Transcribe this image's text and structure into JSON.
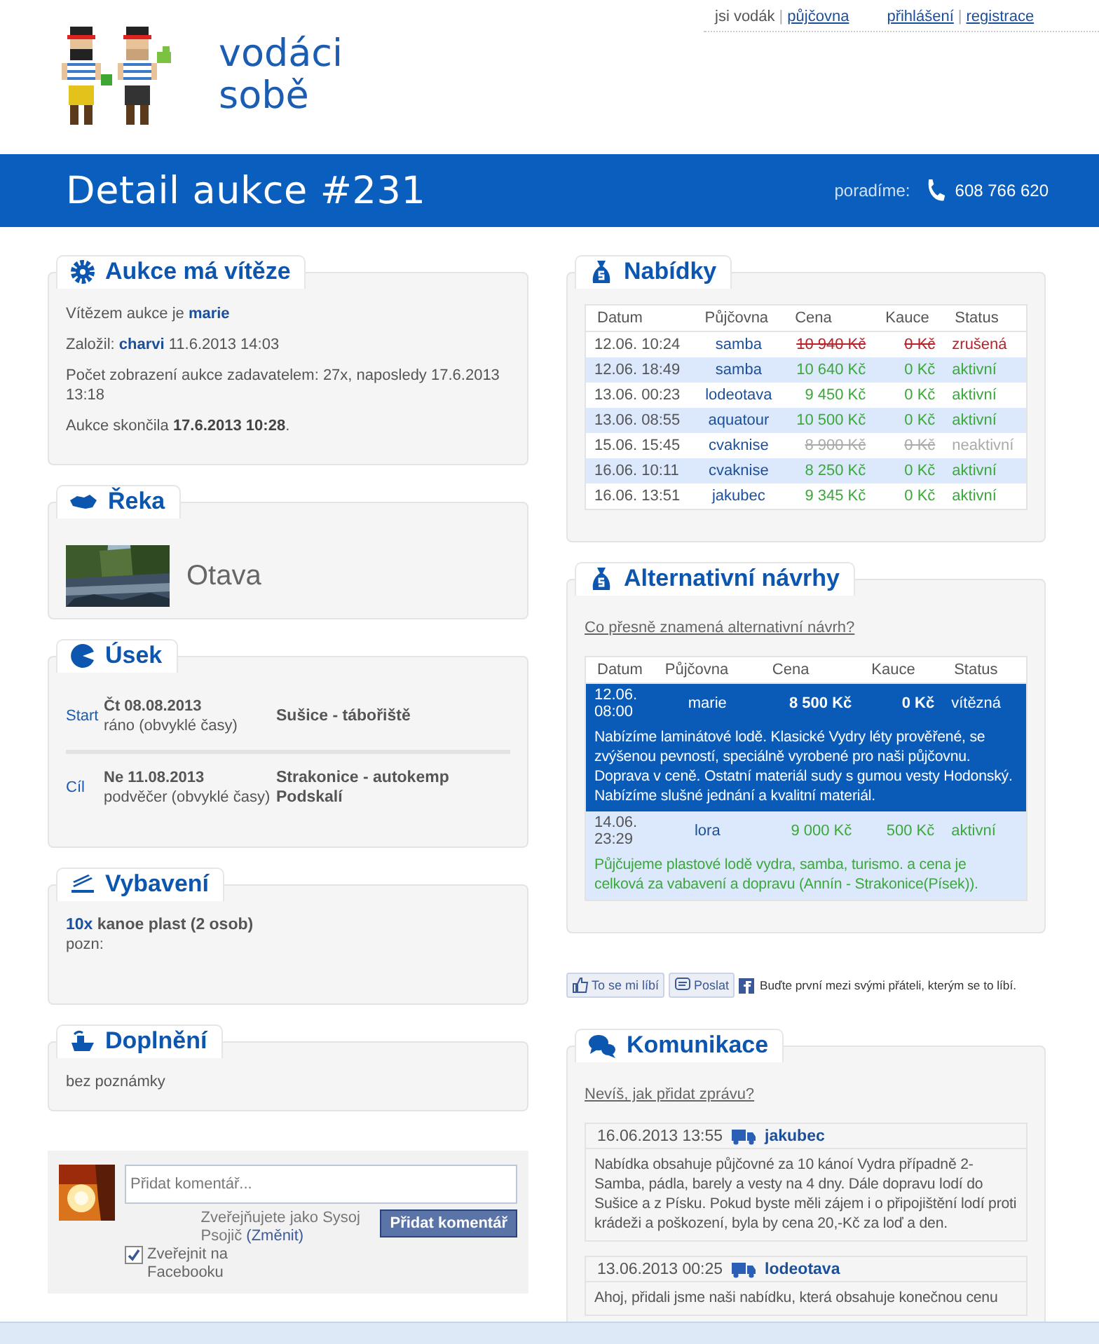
{
  "header": {
    "logo_lines": [
      "vodáci",
      "sobě"
    ],
    "top_nav": [
      {
        "label": "jsi vodák",
        "kind": "text"
      },
      {
        "label": "|",
        "kind": "sep"
      },
      {
        "label": "půjčovna",
        "kind": "link"
      },
      {
        "label": "přihlášení",
        "kind": "link"
      },
      {
        "label": "|",
        "kind": "sep"
      },
      {
        "label": "registrace",
        "kind": "link"
      }
    ]
  },
  "banner": {
    "title": "Detail aukce #231",
    "contact_label": "poradíme:",
    "phone": "608 766 620"
  },
  "winner": {
    "title": "Aukce má vítěze",
    "lines": [
      {
        "text": "Vítězem aukce je **marie**",
        "kind": "user"
      },
      {
        "text": "Založil: **charvi** 11.6.2013 14:03",
        "kind": "user"
      },
      {
        "text": "Počet zobrazení aukce zadavatelem: 27x, naposledy 17.6.2013 13:18",
        "kind": "plain"
      },
      {
        "text": "Aukce skončila **17.6.2013 10:28**.",
        "kind": "date"
      }
    ]
  },
  "river": {
    "title": "Řeka",
    "name": "Otava"
  },
  "section": {
    "title": "Úsek",
    "stops": [
      {
        "label": "Start",
        "date": "Čt 08.08.2013",
        "time": "ráno (obvyklé časy)",
        "place": "Sušice - tábořiště"
      },
      {
        "label": "Cíl",
        "date": "Ne 11.08.2013",
        "time": "podvěčer (obvyklé časy)",
        "place": "Strakonice - autokemp Podskalí"
      }
    ]
  },
  "equipment": {
    "title": "Vybavení",
    "items": [
      {
        "count": "10x",
        "name": "kanoe plast (2 osob)"
      }
    ],
    "note_label": "pozn:"
  },
  "notes": {
    "title": "Doplnění",
    "text": "bez poznámky"
  },
  "fb_comment": {
    "placeholder": "Přidat komentář...",
    "posting_as": "Zveřejňujete jako Sysoj Psojič",
    "change_link": "(Změnit)",
    "button": "Přidat komentář",
    "share": {
      "label": "Zveřejnit na Facebooku",
      "checked": true
    }
  },
  "offers": {
    "title": "Nabídky",
    "columns": [
      "Datum",
      "Půjčovna",
      "Cena",
      "Kauce",
      "Status"
    ],
    "rows": [
      {
        "date": "12.06. 10:24",
        "company": "samba",
        "price": "10 940 Kč",
        "deposit": "0 Kč",
        "status": "zrušená",
        "color": "#b8232a",
        "crossed_out": true
      },
      {
        "date": "12.06. 18:49",
        "company": "samba",
        "price": "10 640 Kč",
        "deposit": "0 Kč",
        "status": "aktivní",
        "color": "#3aa93a",
        "crossed_out": false
      },
      {
        "date": "13.06. 00:23",
        "company": "lodeotava",
        "price": "9 450 Kč",
        "deposit": "0 Kč",
        "status": "aktivní",
        "color": "#3aa93a",
        "crossed_out": false
      },
      {
        "date": "13.06. 08:55",
        "company": "aquatour",
        "price": "10 500 Kč",
        "deposit": "0 Kč",
        "status": "aktivní",
        "color": "#3aa93a",
        "crossed_out": false
      },
      {
        "date": "15.06. 15:45",
        "company": "cvaknise",
        "price": "8 900 Kč",
        "deposit": "0 Kč",
        "status": "neaktivní",
        "color": "#aaaaaa",
        "crossed_out": true
      },
      {
        "date": "16.06. 10:11",
        "company": "cvaknise",
        "price": "8 250 Kč",
        "deposit": "0 Kč",
        "status": "aktivní",
        "color": "#3aa93a",
        "crossed_out": false
      },
      {
        "date": "16.06. 13:51",
        "company": "jakubec",
        "price": "9 345 Kč",
        "deposit": "0 Kč",
        "status": "aktivní",
        "color": "#3aa93a",
        "crossed_out": false
      }
    ]
  },
  "alternatives": {
    "title": "Alternativní návrhy",
    "help_link": "Co přesně znamená alternativní návrh?",
    "columns": [
      "Datum",
      "Půjčovna",
      "Cena",
      "Kauce",
      "Status"
    ],
    "rows": [
      {
        "date": "12.06. 08:00",
        "company": "marie",
        "price": "8 500 Kč",
        "deposit": "0 Kč",
        "status": "vítězná",
        "selected": true,
        "note": "Nabízíme laminátové lodě. Klasické Vydry léty prověřené, se zvýšenou pevností, speciálně vyrobené pro naši půjčovnu. Doprava v ceně. Ostatní materiál sudy s gumou vesty Hodonský. Nabízíme slušné jednání a kvalitní materiál."
      },
      {
        "date": "14.06. 23:29",
        "company": "lora",
        "price": "9 000 Kč",
        "deposit": "500 Kč",
        "status": "aktivní",
        "selected": false,
        "note": "Půjčujeme plastové lodě vydra, samba, turismo. a cena je celková za vabavení a dopravu (Annín - Strakonice(Písek))."
      }
    ]
  },
  "social": {
    "like": "To se mi líbí",
    "send": "Poslat",
    "text": "Buďte první mezi svými přáteli, kterým se to líbí."
  },
  "communication": {
    "title": "Komunikace",
    "help_link": "Nevíš, jak přidat zprávu?",
    "messages": [
      {
        "time": "16.06.2013 13:55",
        "author": "jakubec",
        "text": "Nabídka obsahuje půjčovné za 10 kánoí Vydra případně 2-Samba, pádla, barely a vesty na 4 dny. Dále dopravu lodí do Sušice a z Písku. Pokud byste měli zájem i o připojištění lodí proti krádeži a poškození, byla by cena 20,-Kč za loď a den."
      },
      {
        "time": "13.06.2013 00:25",
        "author": "lodeotava",
        "text": "Ahoj, přidali jsme naši nabídku, která obsahuje konečnou cenu"
      }
    ]
  }
}
